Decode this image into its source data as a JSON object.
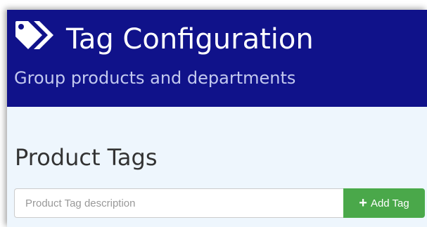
{
  "header": {
    "icon": "tag-icon",
    "title": "Tag Configuration",
    "subtitle": "Group products and departments"
  },
  "main": {
    "section_title": "Product Tags",
    "tag_input": {
      "value": "",
      "placeholder": "Product Tag description"
    },
    "add_button": {
      "icon": "plus-icon",
      "icon_glyph": "+",
      "label": "Add Tag"
    }
  },
  "colors": {
    "header_background": "#10128a",
    "page_background": "#eef6fd",
    "add_button": "#4aa84a"
  }
}
